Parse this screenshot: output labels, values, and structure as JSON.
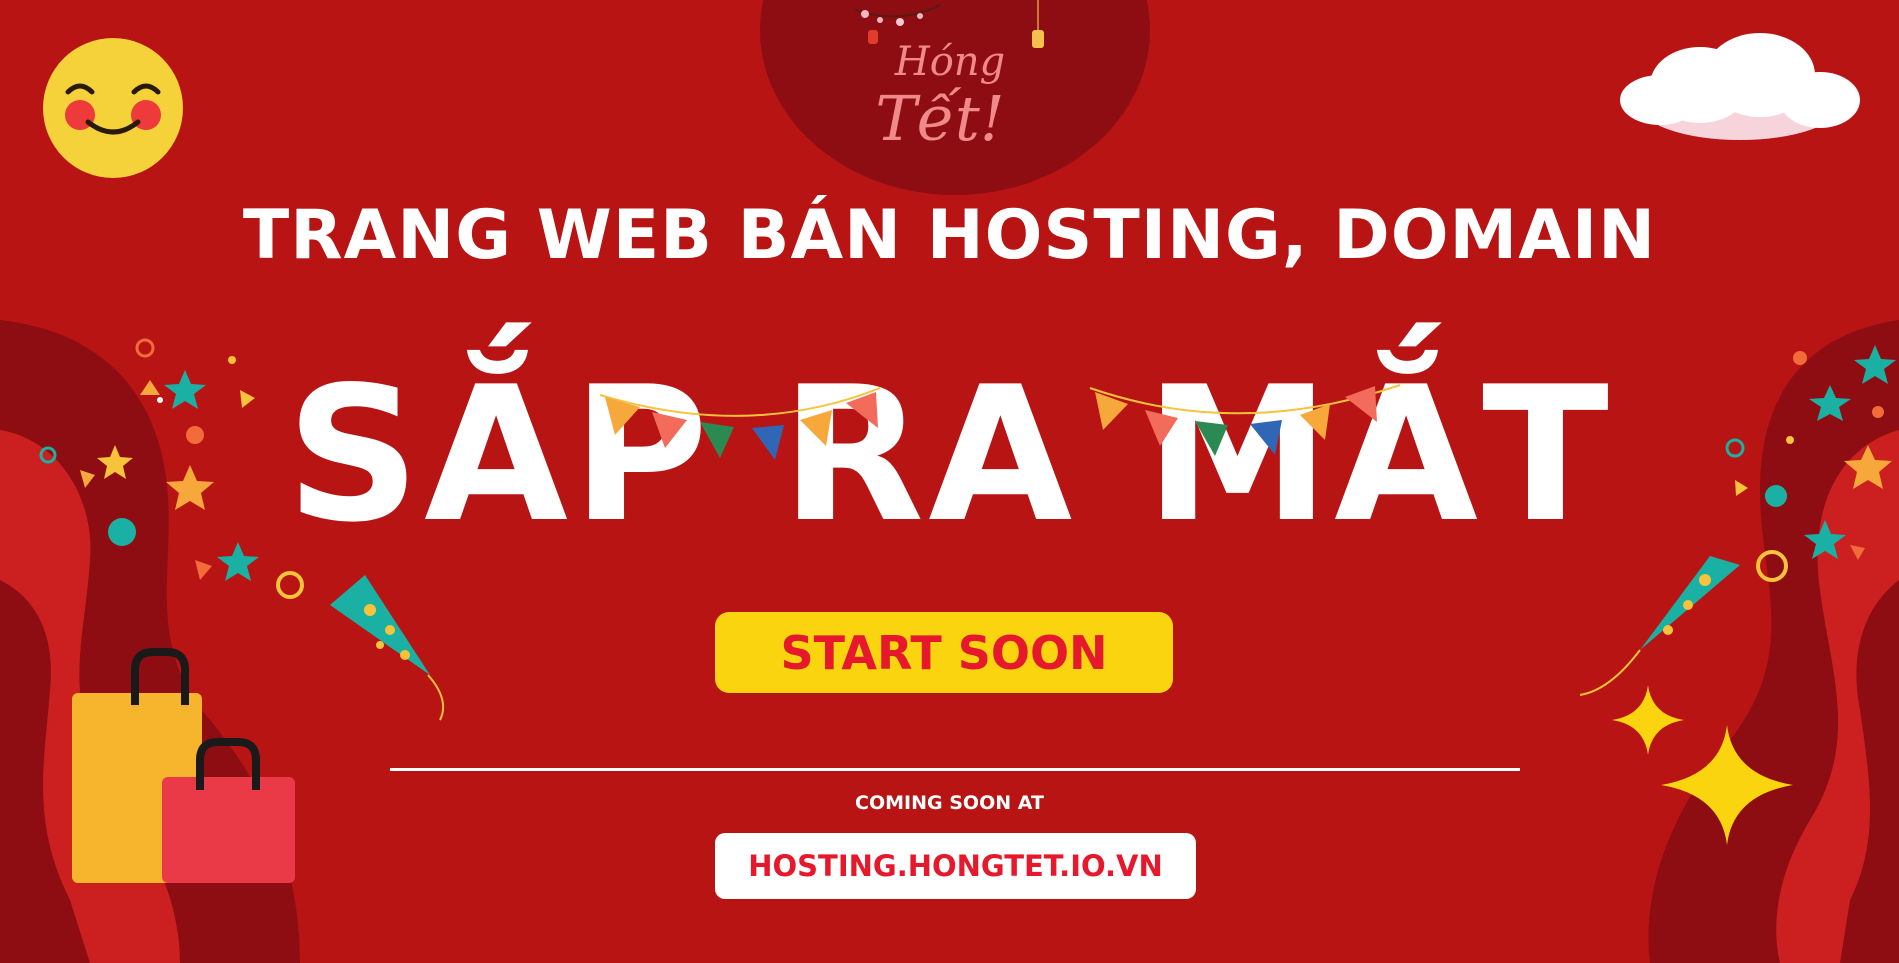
{
  "brand": {
    "line1": "Hóng",
    "line2": "Tết!"
  },
  "headline": "TRANG WEB BÁN HOSTING, DOMAIN",
  "big_title": "SẮP RA MẮT",
  "start_button": "START SOON",
  "coming_label": "COMING SOON AT",
  "url": "HOSTING.HONGTET.IO.VN",
  "colors": {
    "background": "#b81414",
    "button_yellow": "#f9d40f",
    "accent_red": "#e6192c",
    "text_white": "#ffffff"
  }
}
